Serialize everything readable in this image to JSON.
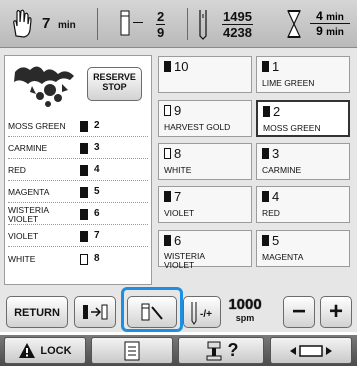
{
  "status": {
    "time_left": "7",
    "time_left_unit": "min",
    "color_current": "2",
    "color_total": "9",
    "stitch_current": "1495",
    "stitch_total": "4238",
    "time_remaining": "4",
    "time_total": "9",
    "time_unit": "min"
  },
  "reserve_stop": {
    "line1": "RESERVE",
    "line2": "STOP"
  },
  "thread_list": [
    {
      "name": "MOSS GREEN",
      "idx": "2",
      "spool": "dark"
    },
    {
      "name": "CARMINE",
      "idx": "3",
      "spool": "dark"
    },
    {
      "name": "RED",
      "idx": "4",
      "spool": "dark"
    },
    {
      "name": "MAGENTA",
      "idx": "5",
      "spool": "dark"
    },
    {
      "name": "WISTERIA VIOLET",
      "idx": "6",
      "spool": "dark"
    },
    {
      "name": "VIOLET",
      "idx": "7",
      "spool": "dark"
    },
    {
      "name": "WHITE",
      "idx": "8",
      "spool": "light"
    }
  ],
  "needle_bars": [
    {
      "num": "10",
      "name": "",
      "spool": "dark"
    },
    {
      "num": "1",
      "name": "LIME GREEN",
      "spool": "dark"
    },
    {
      "num": "9",
      "name": "HARVEST GOLD",
      "spool": "light"
    },
    {
      "num": "2",
      "name": "MOSS GREEN",
      "spool": "dark"
    },
    {
      "num": "8",
      "name": "WHITE",
      "spool": "light"
    },
    {
      "num": "3",
      "name": "CARMINE",
      "spool": "dark"
    },
    {
      "num": "7",
      "name": "VIOLET",
      "spool": "dark"
    },
    {
      "num": "4",
      "name": "RED",
      "spool": "dark"
    },
    {
      "num": "6",
      "name": "WISTERIA VIOLET",
      "spool": "dark"
    },
    {
      "num": "5",
      "name": "MAGENTA",
      "spool": "dark"
    }
  ],
  "bottom": {
    "return_label": "RETURN",
    "speed_value": "1000",
    "speed_unit": "spm",
    "minus": "−",
    "plus": "+"
  },
  "footer": {
    "lock_label": "LOCK",
    "help": "?"
  },
  "colors": {
    "highlight": "#1e8fe0",
    "panel": "#e6e6e6",
    "footer": "#555555"
  }
}
